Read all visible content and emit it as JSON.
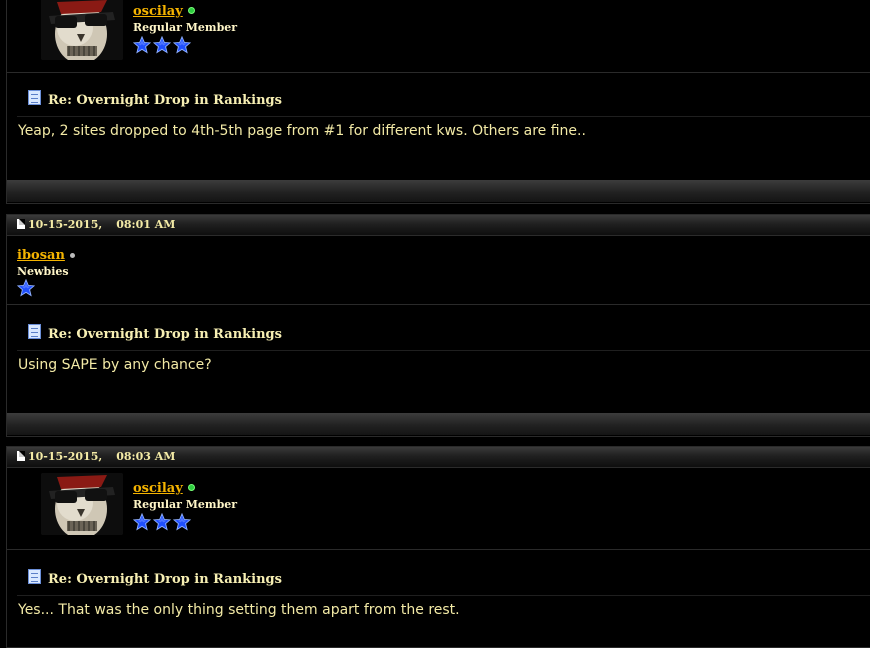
{
  "posts": [
    {
      "date": "",
      "time": "",
      "username": "oscilay",
      "online": true,
      "rank": "Regular Member",
      "stars": 3,
      "title": "Re: Overnight Drop in Rankings",
      "message": "Yeap, 2 sites dropped to 4th-5th page from #1 for different kws. Others are fine.."
    },
    {
      "date": "10-15-2015,",
      "time": "08:01 AM",
      "username": "ibosan",
      "online": false,
      "rank": "Newbies",
      "stars": 1,
      "title": "Re: Overnight Drop in Rankings",
      "message": "Using SAPE by any chance?"
    },
    {
      "date": "10-15-2015,",
      "time": "08:03 AM",
      "username": "oscilay",
      "online": true,
      "rank": "Regular Member",
      "stars": 3,
      "title": "Re: Overnight Drop in Rankings",
      "message": "Yes... That was the only thing setting them apart from the rest."
    }
  ],
  "colors": {
    "username": "#f5b400",
    "text": "#f3eaa6",
    "star": "#1f4fff",
    "background": "#000000"
  },
  "icons": [
    "post-icon",
    "date-icon",
    "online-status-icon",
    "star-icon",
    "avatar-skull"
  ]
}
